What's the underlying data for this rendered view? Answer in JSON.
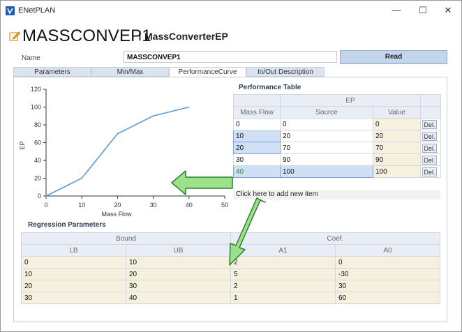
{
  "window": {
    "title": "ENetPLAN",
    "controls": {
      "minimize": "—",
      "maximize": "☐",
      "close": "✕"
    }
  },
  "header": {
    "title": "MASSCONVEP1",
    "separator": "I",
    "subtitle": "MassConverterEP"
  },
  "name_field": {
    "label": "Name",
    "value": "MASSCONVEP1"
  },
  "read_button": "Read",
  "tabs": [
    {
      "label": "Parameters"
    },
    {
      "label": "Min/Max"
    },
    {
      "label": "PerformanceCurve"
    },
    {
      "label": "In/Out Description"
    }
  ],
  "chart_data": {
    "type": "line",
    "x": [
      0,
      10,
      20,
      30,
      40
    ],
    "series": [
      {
        "values": [
          0,
          20,
          70,
          90,
          100
        ]
      }
    ],
    "xlabel": "Mass Flow",
    "ylabel": "EP",
    "xlim": [
      0,
      50
    ],
    "ylim": [
      0,
      120
    ],
    "xticks": [
      "0",
      "10",
      "20",
      "30",
      "40",
      "50"
    ],
    "yticks": [
      "0",
      "20",
      "40",
      "60",
      "80",
      "100",
      "120"
    ],
    "line_color": "#5b9bd5"
  },
  "performance_table": {
    "title": "Performance Table",
    "group_header": "EP",
    "columns": [
      "Mass Flow",
      "Source",
      "Value"
    ],
    "rows": [
      {
        "mass_flow": "0",
        "source": "0",
        "value": "0",
        "action": "Del."
      },
      {
        "mass_flow": "10",
        "source": "20",
        "value": "20",
        "action": "Del."
      },
      {
        "mass_flow": "20",
        "source": "70",
        "value": "70",
        "action": "Del."
      },
      {
        "mass_flow": "30",
        "source": "90",
        "value": "90",
        "action": "Del."
      },
      {
        "mass_flow": "40",
        "source": "100",
        "value": "100",
        "action": "Del."
      }
    ],
    "add_item": "Click here to add new item"
  },
  "regression": {
    "title": "Regression Parameters",
    "groups": [
      "Bound",
      "Coef."
    ],
    "columns": [
      "LB",
      "UB",
      "A1",
      "A0"
    ],
    "rows": [
      [
        "0",
        "10",
        "2",
        "0"
      ],
      [
        "10",
        "20",
        "5",
        "-30"
      ],
      [
        "20",
        "30",
        "2",
        "30"
      ],
      [
        "30",
        "40",
        "1",
        "60"
      ]
    ]
  },
  "colors": {
    "accent": "#c4d5ec",
    "arrow_fill": "#9be08a",
    "arrow_stroke": "#2e7d2e",
    "value_cell": "#f6f1df"
  }
}
